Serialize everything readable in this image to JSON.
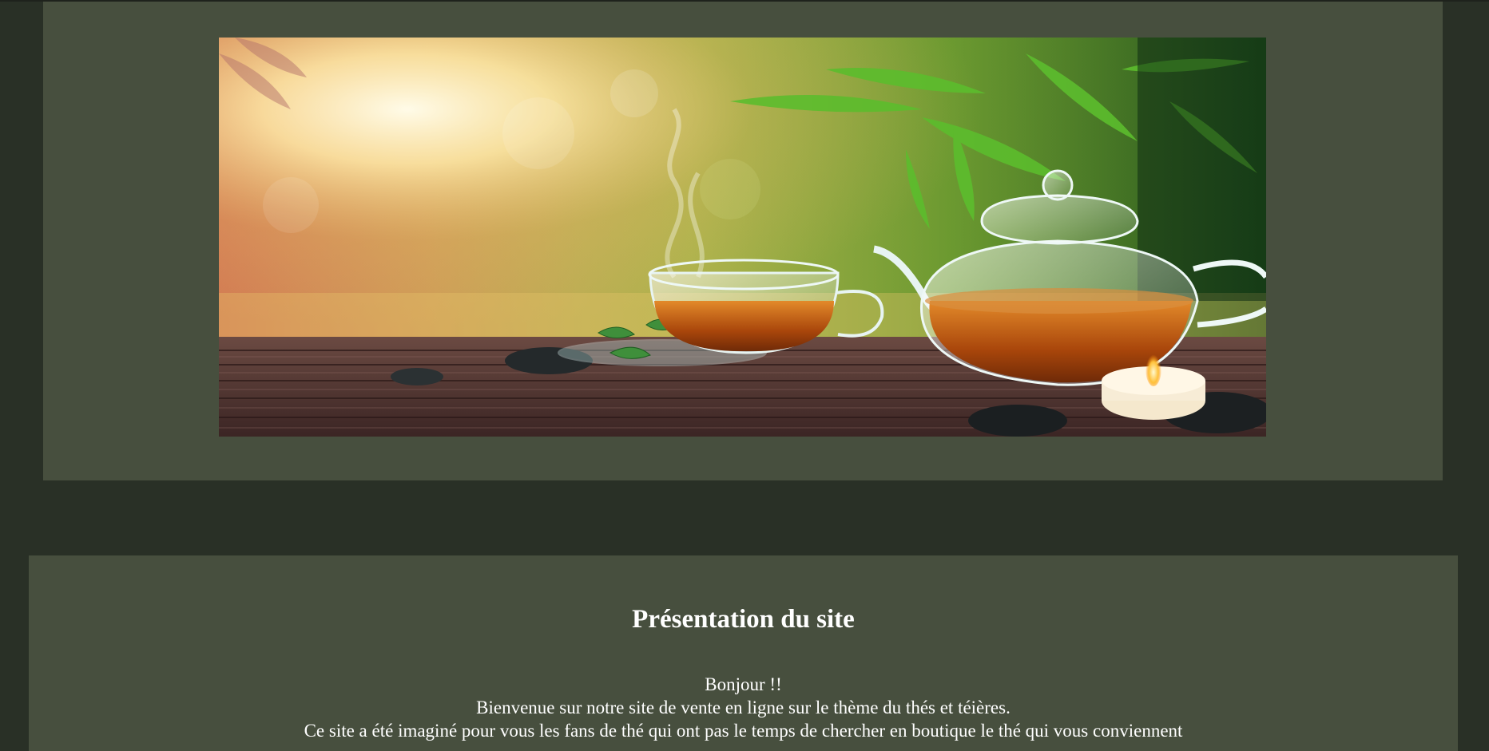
{
  "header": {
    "banner_image": {
      "icon": "tea-banner-image",
      "colors": {
        "sun": "#fff6d8",
        "leaf": "#58b52a",
        "mat": "#5a3a35",
        "tea": "#b9560f",
        "stone": "#1f2325",
        "candle": "#f3e5c8"
      }
    }
  },
  "presentation": {
    "title": "Présentation du site",
    "lines": [
      "Bonjour !!",
      "Bienvenue sur notre site de vente en ligne sur le thème du thés et téières.",
      "Ce site a été imaginé pour vous les fans de thé qui ont pas le temps de chercher en boutique le thé qui vous conviennent"
    ]
  },
  "theme": {
    "page_background": "#293026",
    "panel_background": "#474f3e",
    "text_color": "#ffffff"
  }
}
